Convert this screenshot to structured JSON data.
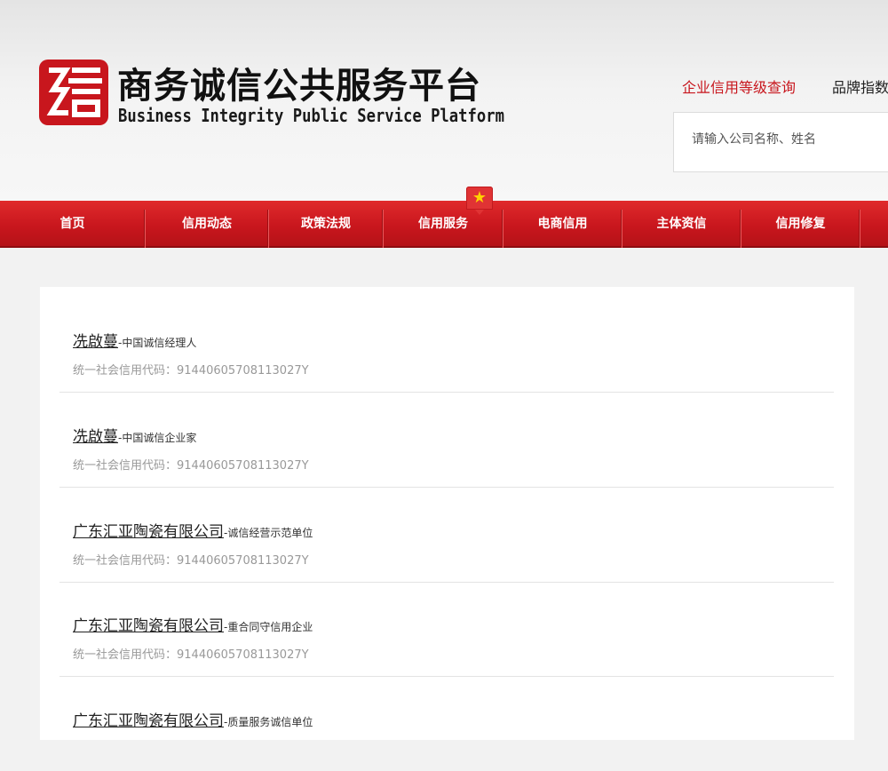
{
  "header": {
    "title_cn": "商务诚信公共服务平台",
    "title_en": "Business Integrity Public Service Platform",
    "logo_icon": "logo-seal-icon",
    "links": [
      "企业信用等级查询",
      "品牌指数"
    ],
    "search": {
      "placeholder": "请输入公司名称、姓名"
    }
  },
  "nav": {
    "items": [
      "首页",
      "信用动态",
      "政策法规",
      "信用服务",
      "电商信用",
      "主体资信",
      "信用修复"
    ],
    "badge_icon": "star-icon",
    "badge_glyph": "★"
  },
  "results": [
    {
      "name": "冼啟蔓",
      "dash": "-",
      "tag": "中国诚信经理人",
      "code": "统一社会信用代码：91440605708113027Y"
    },
    {
      "name": "冼啟蔓",
      "dash": "-",
      "tag": "中国诚信企业家",
      "code": "统一社会信用代码：91440605708113027Y"
    },
    {
      "name": "广东汇亚陶瓷有限公司",
      "dash": "-",
      "tag": "诚信经营示范单位",
      "code": "统一社会信用代码：91440605708113027Y"
    },
    {
      "name": "广东汇亚陶瓷有限公司",
      "dash": "-",
      "tag": "重合同守信用企业",
      "code": "统一社会信用代码：91440605708113027Y"
    },
    {
      "name": "广东汇亚陶瓷有限公司",
      "dash": "-",
      "tag": "质量服务诚信单位",
      "code": ""
    }
  ],
  "colors": {
    "brand_red": "#c8161d",
    "badge_star": "#ffd200"
  }
}
